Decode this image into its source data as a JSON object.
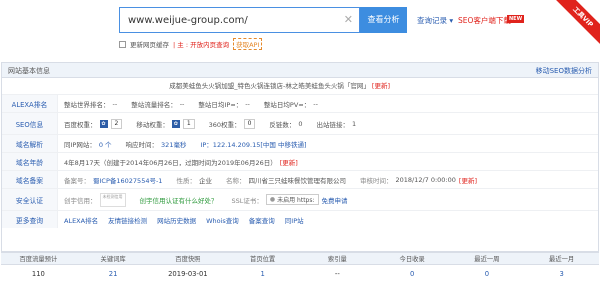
{
  "search": {
    "value": "www.weijue-group.com/",
    "clear_icon": "close-icon",
    "button": "查看分析"
  },
  "header_links": {
    "query_log": "查询记录 ▾",
    "seo_download": "SEO客户端下载",
    "new_badge": "NEW",
    "ribbon": "工具VIP"
  },
  "options": {
    "update_label": "更新网页缓存",
    "update_tip": "| 主 : 开放内页查询",
    "api_label": "获取API"
  },
  "panel": {
    "title": "网站基本信息",
    "mobile_link": "移动SEO数据分析"
  },
  "site_title": {
    "text": "成都美蛙鱼头火锅加盟_特色火锅连锁店-林之皓美蛙鱼头火锅「官网」",
    "update": "[更新]"
  },
  "rows": {
    "alexa": {
      "label": "ALEXA排名",
      "items": [
        "整站世界排名：",
        "--",
        "整站流量排名：",
        "--",
        "整站日均IP≈：",
        "--",
        "整站日均PV≈：",
        "--"
      ]
    },
    "seo": {
      "label": "SEO信息",
      "baidu": "百度权重：",
      "baidu_val": "2",
      "mobile": "移动权重：",
      "mobile_val": "1",
      "s360": "360权重：",
      "s360_val": "0",
      "sogou": "反链数：",
      "sogou_val": "0",
      "outlink": "出站链接：",
      "outlink_val": "1"
    },
    "dns": {
      "label": "域名解析",
      "same_ip": "同IP网站：",
      "same_ip_val": "0 个",
      "speed": "响应时间：",
      "speed_val": "321毫秒",
      "ip": "IP：122.14.209.15[中国 中移铁通]"
    },
    "age": {
      "label": "域名年龄",
      "text": "4年8月17天（创建于2014年06月26日，过期时间为2019年06月26日）",
      "update": "[更新]"
    },
    "icp": {
      "label": "域名备案",
      "no_label": "备案号：",
      "no_val": "蜀ICP备16027554号-1",
      "nature_label": "性质：",
      "nature_val": "企业",
      "name_label": "名称：",
      "name_val": "四川省三只蛙味餐饮管理有限公司",
      "date_label": "审核时间：",
      "date_val": "2018/12/7 0:00:00",
      "update": "[更新]"
    },
    "trust": {
      "label": "安全认证",
      "create_label": "创宇信用：",
      "img_text": "未检测信用",
      "trust_q": "创宇信用认证有什么好处？",
      "ssl_label": "SSL证书：",
      "ssl_val": "未启用 https:",
      "ssl_apply": "免费申请"
    },
    "more": {
      "label": "更多查询",
      "links": [
        "ALEXA排名",
        "友情链接检测",
        "网站历史数据",
        "Whois查询",
        "备案查询",
        "同IP站"
      ]
    }
  },
  "bottom_table": {
    "headers": [
      "百度流量预计",
      "关键词库",
      "百度快照",
      "首页位置",
      "索引量",
      "今日收录",
      "最近一周",
      "最近一月"
    ],
    "values": [
      "110",
      "21",
      "2019-03-01",
      "1",
      "--",
      "0",
      "0",
      "3"
    ]
  }
}
